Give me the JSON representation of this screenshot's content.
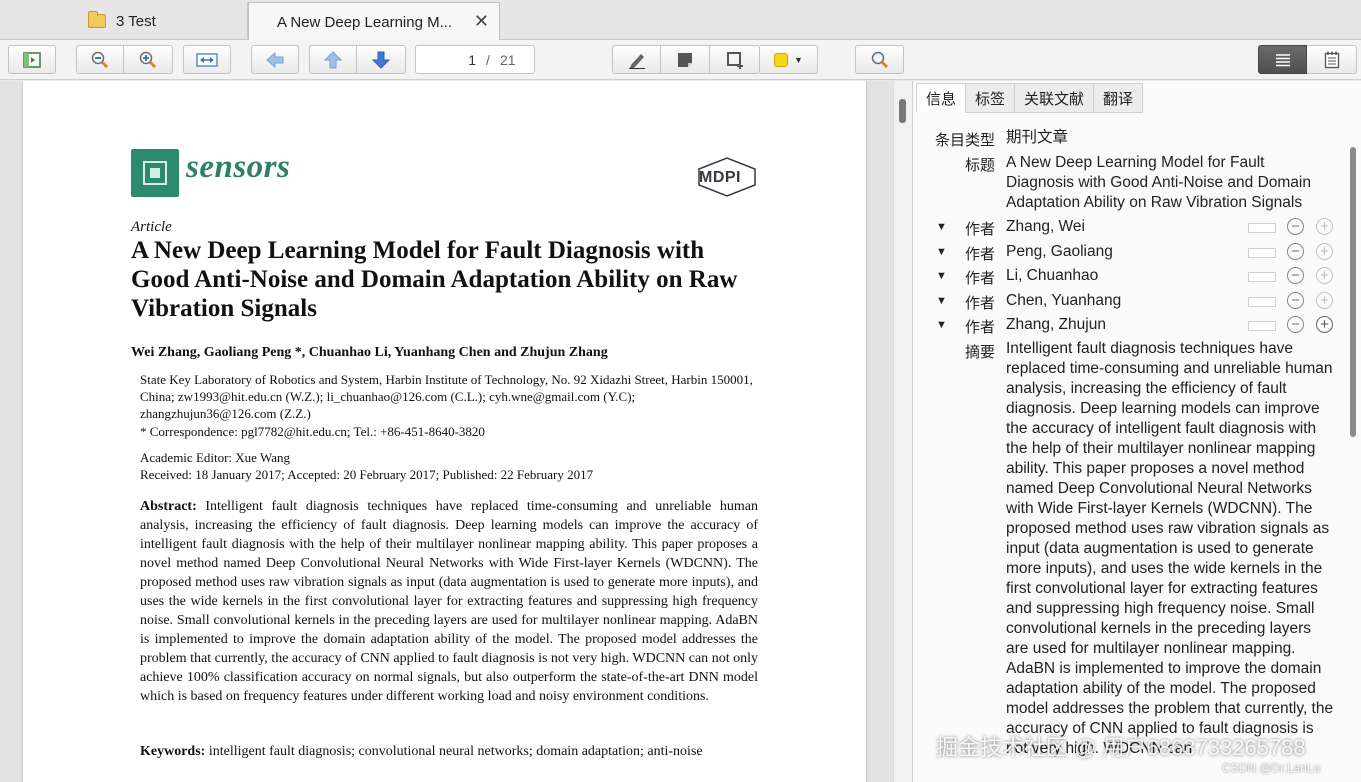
{
  "tabs": [
    {
      "label": "3 Test"
    },
    {
      "label": "A New Deep Learning M..."
    }
  ],
  "toolbar": {
    "page_current": "1",
    "page_separator": "/",
    "page_total": "21",
    "highlight_color": "#f7d51a"
  },
  "pdf": {
    "journal": "sensors",
    "publisher": "MDPI",
    "article_type": "Article",
    "title": "A New Deep Learning Model for Fault Diagnosis with Good Anti-Noise and Domain Adaptation Ability on Raw Vibration Signals",
    "authors": "Wei Zhang, Gaoliang Peng *, Chuanhao Li, Yuanhang Chen and Zhujun Zhang",
    "affiliation": "State Key Laboratory of Robotics and System, Harbin Institute of Technology, No. 92 Xidazhi Street, Harbin 150001, China; zw1993@hit.edu.cn (W.Z.); li_chuanhao@126.com (C.L.); cyh.wne@gmail.com (Y.C); zhangzhujun36@126.com (Z.Z.)",
    "correspondence": "*  Correspondence: pgl7782@hit.edu.cn; Tel.: +86-451-8640-3820",
    "editor": "Academic Editor: Xue Wang",
    "dates": "Received: 18 January 2017; Accepted: 20 February 2017; Published: 22 February 2017",
    "abstract_label": "Abstract:",
    "abstract": "Intelligent fault diagnosis techniques have replaced time-consuming and unreliable human analysis, increasing the efficiency of fault diagnosis. Deep learning models can improve the accuracy of intelligent fault diagnosis with the help of their multilayer nonlinear mapping ability. This paper proposes a novel method named Deep Convolutional Neural Networks with Wide First-layer Kernels (WDCNN). The proposed method uses raw vibration signals as input (data augmentation is used to generate more inputs), and uses the wide kernels in the first convolutional layer for extracting features and suppressing high frequency noise. Small convolutional kernels in the preceding layers are used for multilayer nonlinear mapping. AdaBN is implemented to improve the domain adaptation ability of the model. The proposed model addresses the problem that currently, the accuracy of CNN applied to fault diagnosis is not very high. WDCNN can not only achieve 100% classification accuracy on normal signals, but also outperform the state-of-the-art DNN model which is based on frequency features under different working load and noisy environment conditions.",
    "keywords_label": "Keywords:",
    "keywords": "intelligent fault diagnosis; convolutional neural networks; domain adaptation; anti-noise"
  },
  "panel": {
    "tabs": [
      "信息",
      "标签",
      "关联文献",
      "翻译"
    ],
    "item_type_label": "条目类型",
    "item_type": "期刊文章",
    "title_label": "标题",
    "title": "A New Deep Learning Model for Fault Diagnosis with Good Anti-Noise and Domain Adaptation Ability on Raw Vibration Signals",
    "author_label": "作者",
    "authors": [
      "Zhang, Wei",
      "Peng, Gaoliang",
      "Li, Chuanhao",
      "Chen, Yuanhang",
      "Zhang, Zhujun"
    ],
    "abstract_label": "摘要",
    "abstract": "Intelligent fault diagnosis techniques have replaced time-consuming and unreliable human analysis, increasing the efficiency of fault diagnosis. Deep learning models can improve the accuracy of intelligent fault diagnosis with the help of their multilayer nonlinear mapping ability. This paper proposes a novel method named Deep Convolutional Neural Networks with Wide First-layer Kernels (WDCNN). The proposed method uses raw vibration signals as input (data augmentation is used to generate more inputs), and uses the wide kernels in the first convolutional layer for extracting features and suppressing high frequency noise. Small convolutional kernels in the preceding layers are used for multilayer nonlinear mapping. AdaBN is implemented to improve the domain adaptation ability of the model. The proposed model addresses the problem that currently, the accuracy of CNN applied to fault diagnosis is not very high. WDCNN can"
  },
  "watermark": {
    "text": "掘金技术社区 @ 用户6863733265788",
    "sub": "CSDN @Dr.LanLu"
  }
}
